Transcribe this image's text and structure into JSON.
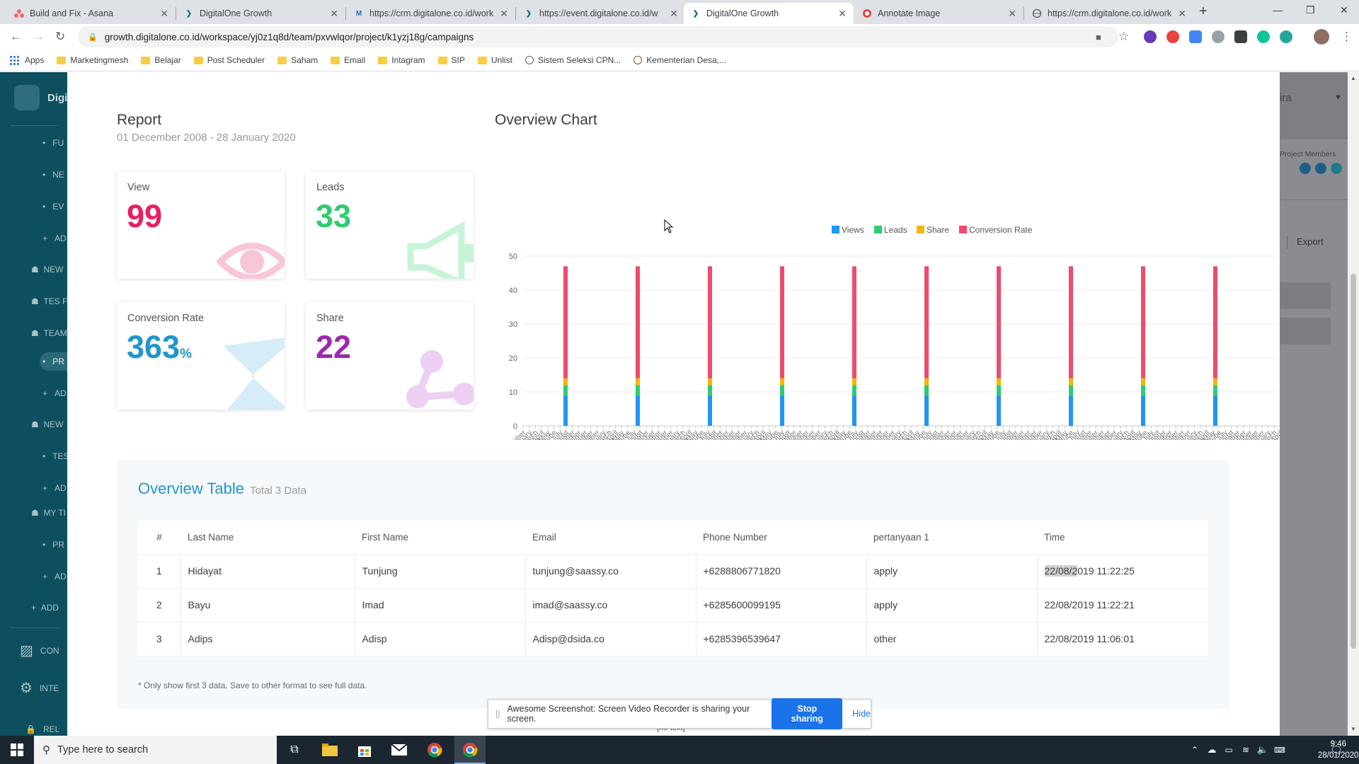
{
  "browser": {
    "tabs": [
      {
        "title": "Build and Fix - Asana",
        "icon": "asana-icon",
        "color": "#f06a6a"
      },
      {
        "title": "DigitalOne Growth",
        "icon": "digitalone-icon",
        "color": "#1e6a80"
      },
      {
        "title": "https://crm.digitalone.co.id/work",
        "icon": "crm-icon",
        "color": "#2b6cb0"
      },
      {
        "title": "https://event.digitalone.co.id/w",
        "icon": "digitalone-icon",
        "color": "#1e6a80"
      },
      {
        "title": "DigitalOne Growth",
        "icon": "digitalone-icon",
        "color": "#1e6a80",
        "active": true
      },
      {
        "title": "Annotate Image",
        "icon": "annotate-icon",
        "color": "#e8453c"
      },
      {
        "title": "https://crm.digitalone.co.id/work",
        "icon": "globe-icon",
        "color": "#5f6368"
      }
    ],
    "url": "growth.digitalone.co.id/workspace/yj0z1q8d/team/pxvwlqor/project/k1yzj18g/campaigns",
    "bookmarks": [
      "Apps",
      "Marketingmesh",
      "Belajar",
      "Post Scheduler",
      "Saham",
      "Email",
      "Intagram",
      "SIP",
      "Unlist",
      "Sistem Seleksi CPN...",
      "Kementerian Desa,..."
    ]
  },
  "sidebar": {
    "brand": "Digi",
    "items": [
      "FU",
      "NE",
      "EV",
      "AD",
      "NEW",
      "TES F",
      "TEAM",
      "PR",
      "AD",
      "NEW",
      "TES",
      "AD",
      "MY TI",
      "PR",
      "AD",
      "ADD",
      "CON",
      "INTE",
      "REL"
    ]
  },
  "right_panel": {
    "title_partial": "ira",
    "members_label": "Project Members",
    "export_label": "Export"
  },
  "report": {
    "title": "Report",
    "date_range": "01 December 2008 - 28 January 2020",
    "cards": {
      "view": {
        "label": "View",
        "value": "99",
        "color": "#e91e63"
      },
      "leads": {
        "label": "Leads",
        "value": "33",
        "color": "#2ecc71"
      },
      "conversion": {
        "label": "Conversion Rate",
        "value": "363",
        "unit": "%",
        "color": "#2196c9"
      },
      "share": {
        "label": "Share",
        "value": "22",
        "color": "#9c27b0"
      }
    }
  },
  "chart": {
    "title": "Overview Chart"
  },
  "chart_data": {
    "type": "bar",
    "stacked": true,
    "legend_position": "top",
    "ylim": [
      0,
      50
    ],
    "yticks": [
      0,
      10,
      20,
      30,
      40,
      50
    ],
    "grid": true,
    "series": [
      {
        "name": "Views",
        "color": "#2196f3",
        "value": 9
      },
      {
        "name": "Leads",
        "color": "#2ecc71",
        "value": 3
      },
      {
        "name": "Share",
        "color": "#f5b700",
        "value": 2
      },
      {
        "name": "Conversion Rate",
        "color": "#ef4b6c",
        "value": 33
      }
    ],
    "bar_groups": 11,
    "x_tick_labels": [
      "December",
      "February",
      "March",
      "April",
      "May",
      "June",
      "July",
      "August",
      "September",
      "October",
      "November",
      "December"
    ]
  },
  "table": {
    "title": "Overview Table",
    "subtitle": "Total 3 Data",
    "columns": [
      "#",
      "Last Name",
      "First Name",
      "Email",
      "Phone Number",
      "pertanyaan 1",
      "Time"
    ],
    "rows": [
      {
        "no": "1",
        "last": "Hidayat",
        "first": "Tunjung",
        "email": "tunjung@saassy.co",
        "phone": "+6288806771820",
        "q1": "apply",
        "time_hl": "22/08/2",
        "time_rest": "019 11:22:25"
      },
      {
        "no": "2",
        "last": "Bayu",
        "first": "Imad",
        "email": "imad@saassy.co",
        "phone": "+6285600099195",
        "q1": "apply",
        "time_hl": "",
        "time_rest": "22/08/2019 11:22:21"
      },
      {
        "no": "3",
        "last": "Adips",
        "first": "Adisp",
        "email": "Adisp@dsida.co",
        "phone": "+6285396539647",
        "q1": "other",
        "time_hl": "",
        "time_rest": "22/08/2019 11:06:01"
      }
    ],
    "footnote": "* Only show first 3 data. Save to other format to see full data."
  },
  "notice": {
    "text": "Awesome Screenshot: Screen Video Recorder is sharing your screen.",
    "stop_label": "Stop sharing",
    "hide_label": "Hide",
    "below_text": "[no-text]"
  },
  "taskbar": {
    "search_placeholder": "Type here to search",
    "time": "9:46",
    "date": "28/01/2020"
  }
}
